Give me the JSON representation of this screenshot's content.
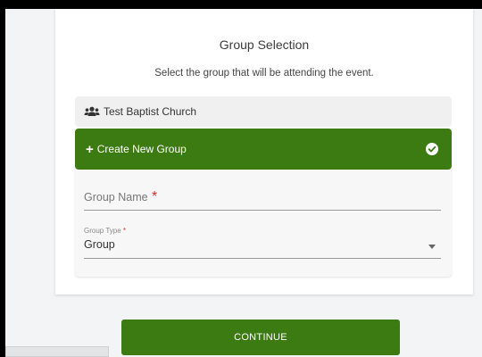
{
  "header": {
    "title": "Group Selection",
    "subtitle": "Select the group that will be attending the event."
  },
  "groups": [
    {
      "label": "Test Baptist Church",
      "icon": "users-icon"
    }
  ],
  "create_group": {
    "label": "Create New Group",
    "icon": "plus-icon",
    "status_icon": "check-circle-icon"
  },
  "form": {
    "group_name": {
      "label": "Group Name",
      "required_mark": "*",
      "value": ""
    },
    "group_type": {
      "label": "Group Type",
      "required_mark": "*",
      "value": "Group"
    }
  },
  "actions": {
    "continue_label": "CONTINUE"
  },
  "colors": {
    "primary_green": "#3c7a12",
    "required_red": "#d32f2f"
  }
}
